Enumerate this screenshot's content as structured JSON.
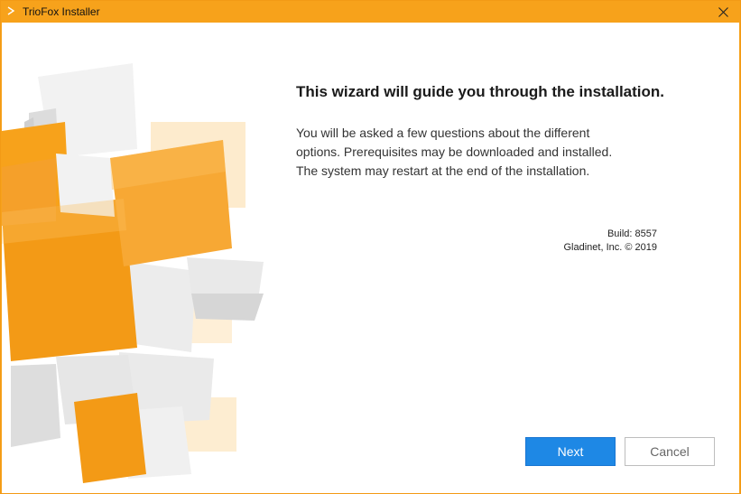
{
  "window": {
    "title": "TrioFox Installer",
    "accent_color": "#f7a21b",
    "icons": {
      "app": "triofox-app-icon",
      "close": "close-icon"
    }
  },
  "content": {
    "headline": "This wizard will guide you through the installation.",
    "description_lines": [
      "You will be asked a few questions about the different",
      "options. Prerequisites may be downloaded and installed.",
      "The system may restart at the end of the installation."
    ],
    "build_label": "Build: 8557",
    "copyright": "Gladinet, Inc. © 2019"
  },
  "buttons": {
    "next_label": "Next",
    "cancel_label": "Cancel",
    "next_color": "#1e88e5"
  }
}
